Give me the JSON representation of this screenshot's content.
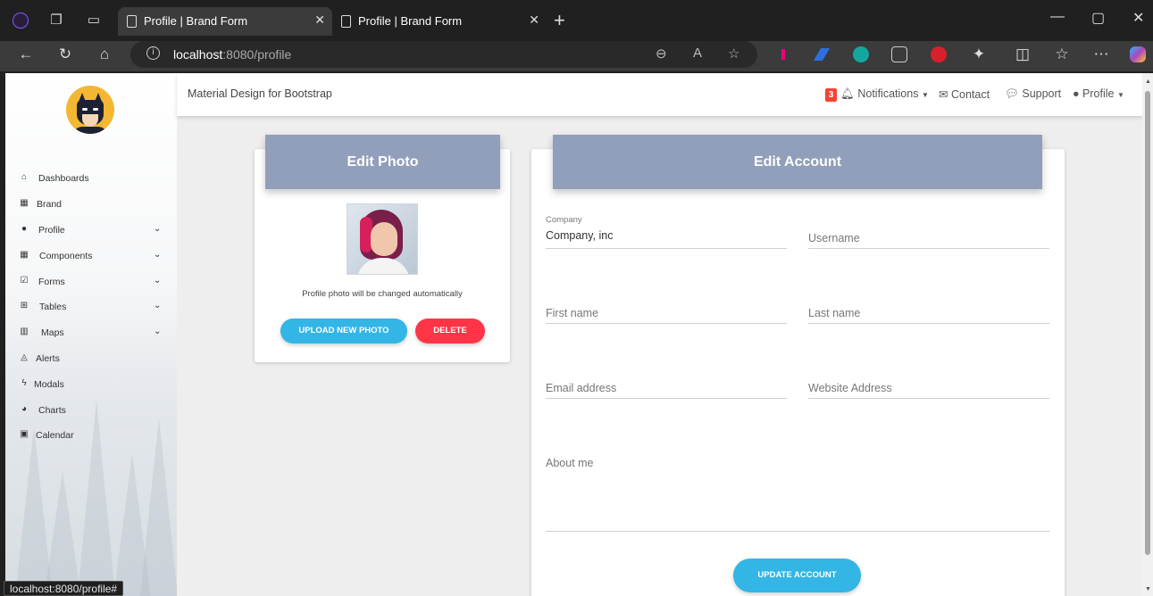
{
  "browser": {
    "tabs": [
      {
        "title": "Profile | Brand Form",
        "active": true
      },
      {
        "title": "Profile | Brand Form",
        "active": false
      }
    ],
    "url_host": "localhost",
    "url_rest": ":8080/profile",
    "status_url": "localhost:8080/profile#"
  },
  "sidebar": {
    "items": [
      {
        "label": "Dashboards",
        "icon": "home-icon",
        "glyph": "⌂",
        "expandable": false
      },
      {
        "label": "Brand",
        "icon": "grid-icon",
        "glyph": "▦",
        "expandable": false
      },
      {
        "label": "Profile",
        "icon": "user-icon",
        "glyph": "●",
        "expandable": true
      },
      {
        "label": "Components",
        "icon": "apps-icon",
        "glyph": "▦",
        "expandable": true
      },
      {
        "label": "Forms",
        "icon": "checkbox-icon",
        "glyph": "☑",
        "expandable": true
      },
      {
        "label": "Tables",
        "icon": "table-icon",
        "glyph": "⊞",
        "expandable": true
      },
      {
        "label": "Maps",
        "icon": "map-icon",
        "glyph": "▥",
        "expandable": true
      },
      {
        "label": "Alerts",
        "icon": "bell-icon",
        "glyph": "◬",
        "expandable": false
      },
      {
        "label": "Modals",
        "icon": "bolt-icon",
        "glyph": "ϟ",
        "expandable": false
      },
      {
        "label": "Charts",
        "icon": "pie-chart-icon",
        "glyph": "◕",
        "expandable": false
      },
      {
        "label": "Calendar",
        "icon": "calendar-icon",
        "glyph": "▣",
        "expandable": false
      }
    ]
  },
  "topnav": {
    "brand": "Material Design for Bootstrap",
    "notif_count": "3",
    "notifications": "Notifications",
    "contact": "Contact",
    "support": "Support",
    "profile": "Profile"
  },
  "photo_card": {
    "title": "Edit Photo",
    "caption": "Profile photo will be changed automatically",
    "upload_label": "UPLOAD NEW PHOTO",
    "delete_label": "DELETE"
  },
  "account_card": {
    "title": "Edit Account",
    "company_label": "Company",
    "company_value": "Company, inc",
    "username_label": "Username",
    "firstname_label": "First name",
    "lastname_label": "Last name",
    "email_label": "Email address",
    "website_label": "Website Address",
    "about_label": "About me",
    "update_label": "UPDATE ACCOUNT"
  },
  "colors": {
    "card_header": "#919fbb",
    "upload_button": "#33b5e5",
    "delete_button": "#ff3547",
    "badge": "#f44336"
  }
}
